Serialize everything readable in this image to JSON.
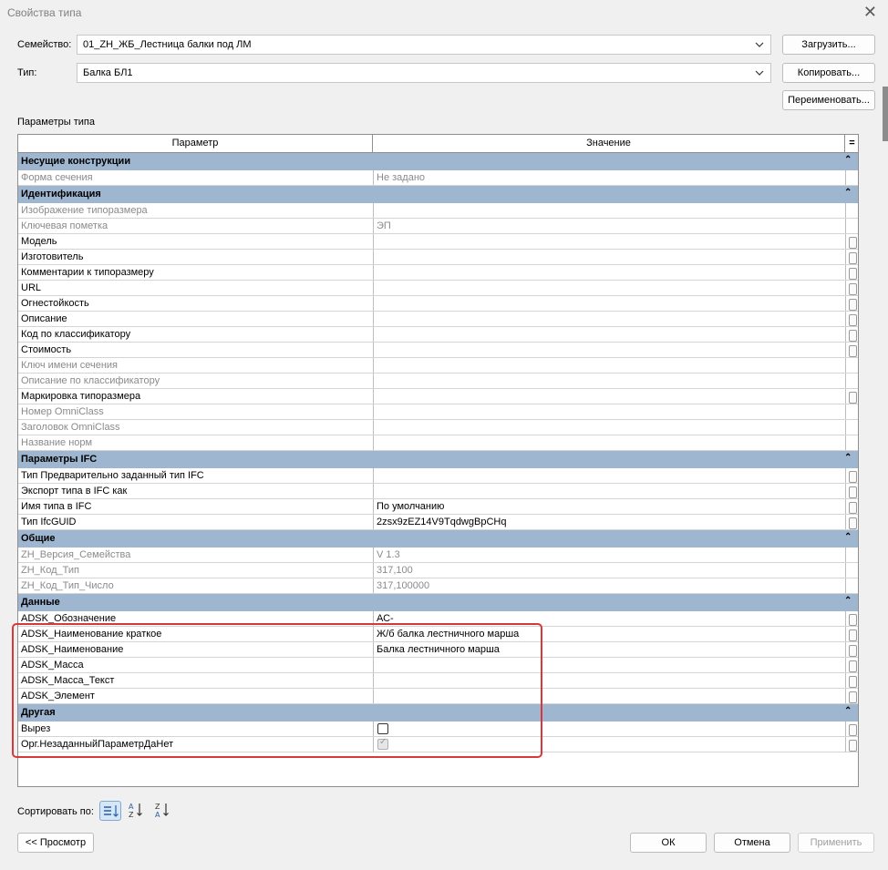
{
  "window": {
    "title": "Свойства типа"
  },
  "family": {
    "label": "Семейство:",
    "value": "01_ZH_ЖБ_Лестница балки под ЛМ"
  },
  "type": {
    "label": "Тип:",
    "value": "Балка БЛ1"
  },
  "buttons": {
    "load": "Загрузить...",
    "duplicate": "Копировать...",
    "rename": "Переименовать...",
    "preview": "<< Просмотр",
    "ok": "ОК",
    "cancel": "Отмена",
    "apply": "Применить"
  },
  "section_label": "Параметры типа",
  "grid": {
    "col_param": "Параметр",
    "col_value": "Значение",
    "col_toggle": "="
  },
  "sort": {
    "label": "Сортировать по:"
  },
  "rows": [
    {
      "kind": "group",
      "name": "Несущие конструкции"
    },
    {
      "kind": "param",
      "name": "Форма сечения",
      "value": "Не задано",
      "grey": true,
      "eb": false
    },
    {
      "kind": "group",
      "name": "Идентификация"
    },
    {
      "kind": "param",
      "name": "Изображение типоразмера",
      "value": "",
      "grey": true,
      "eb": false
    },
    {
      "kind": "param",
      "name": "Ключевая пометка",
      "value": "ЭП",
      "grey": true,
      "eb": false
    },
    {
      "kind": "param",
      "name": "Модель",
      "value": "",
      "grey": false,
      "eb": true
    },
    {
      "kind": "param",
      "name": "Изготовитель",
      "value": "",
      "grey": false,
      "eb": true
    },
    {
      "kind": "param",
      "name": "Комментарии к типоразмеру",
      "value": "",
      "grey": false,
      "eb": true
    },
    {
      "kind": "param",
      "name": "URL",
      "value": "",
      "grey": false,
      "eb": true
    },
    {
      "kind": "param",
      "name": "Огнестойкость",
      "value": "",
      "grey": false,
      "eb": true
    },
    {
      "kind": "param",
      "name": "Описание",
      "value": "",
      "grey": false,
      "eb": true
    },
    {
      "kind": "param",
      "name": "Код по классификатору",
      "value": "",
      "grey": false,
      "eb": true
    },
    {
      "kind": "param",
      "name": "Стоимость",
      "value": "",
      "grey": false,
      "eb": true
    },
    {
      "kind": "param",
      "name": "Ключ имени сечения",
      "value": "",
      "grey": true,
      "eb": false
    },
    {
      "kind": "param",
      "name": "Описание по классификатору",
      "value": "",
      "grey": true,
      "eb": false
    },
    {
      "kind": "param",
      "name": "Маркировка типоразмера",
      "value": "",
      "grey": false,
      "eb": true
    },
    {
      "kind": "param",
      "name": "Номер OmniClass",
      "value": "",
      "grey": true,
      "eb": false
    },
    {
      "kind": "param",
      "name": "Заголовок OmniClass",
      "value": "",
      "grey": true,
      "eb": false
    },
    {
      "kind": "param",
      "name": "Название норм",
      "value": "",
      "grey": true,
      "eb": false
    },
    {
      "kind": "group",
      "name": "Параметры IFC"
    },
    {
      "kind": "param",
      "name": "Тип Предварительно заданный тип IFC",
      "value": "",
      "grey": false,
      "eb": true
    },
    {
      "kind": "param",
      "name": "Экспорт типа в IFC как",
      "value": "",
      "grey": false,
      "eb": true
    },
    {
      "kind": "param",
      "name": "Имя типа в IFC",
      "value": "По умолчанию",
      "grey": false,
      "eb": true
    },
    {
      "kind": "param",
      "name": "Тип IfcGUID",
      "value": "2zsx9zEZ14V9TqdwgBpCHq",
      "grey": false,
      "eb": true
    },
    {
      "kind": "group",
      "name": "Общие"
    },
    {
      "kind": "param",
      "name": "ZH_Версия_Семейства",
      "value": "V 1.3",
      "grey": true,
      "eb": false
    },
    {
      "kind": "param",
      "name": "ZH_Код_Тип",
      "value": "317,100",
      "grey": true,
      "eb": false
    },
    {
      "kind": "param",
      "name": "ZH_Код_Тип_Число",
      "value": "317,100000",
      "grey": true,
      "eb": false
    },
    {
      "kind": "group",
      "name": "Данные"
    },
    {
      "kind": "param",
      "name": "ADSK_Обозначение",
      "value": "АС-",
      "grey": false,
      "eb": true
    },
    {
      "kind": "param",
      "name": "ADSK_Наименование краткое",
      "value": "Ж/б балка лестничного марша",
      "grey": false,
      "eb": true
    },
    {
      "kind": "param",
      "name": "ADSK_Наименование",
      "value": "Балка лестничного марша",
      "grey": false,
      "eb": true
    },
    {
      "kind": "param",
      "name": "ADSK_Масса",
      "value": "",
      "grey": false,
      "eb": true
    },
    {
      "kind": "param",
      "name": "ADSK_Масса_Текст",
      "value": "",
      "grey": false,
      "eb": true
    },
    {
      "kind": "param",
      "name": "ADSK_Элемент",
      "value": "",
      "grey": false,
      "eb": true
    },
    {
      "kind": "group",
      "name": "Другая"
    },
    {
      "kind": "param",
      "name": "Вырез",
      "value": "",
      "check": "on",
      "grey": false,
      "eb": true
    },
    {
      "kind": "param",
      "name": "Орг.НезаданныйПараметрДаНет",
      "value": "",
      "check": "disabled",
      "grey": false,
      "eb": true
    }
  ]
}
